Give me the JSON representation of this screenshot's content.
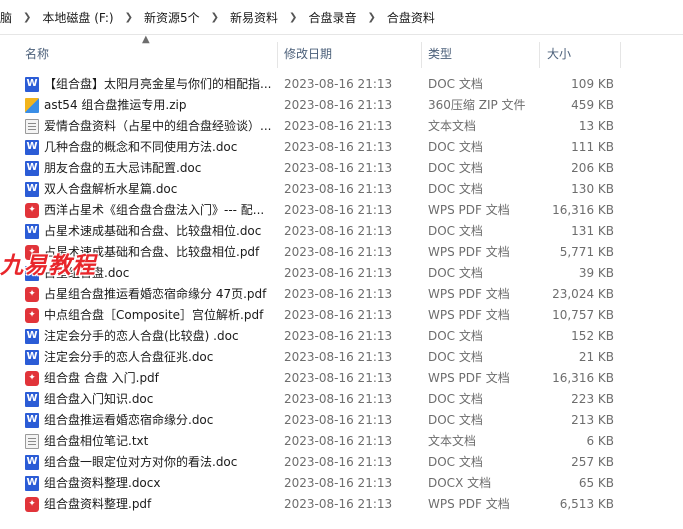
{
  "breadcrumb": [
    "脑",
    "本地磁盘 (F:)",
    "新资源5个",
    "新易资料",
    "合盘录音",
    "合盘资料"
  ],
  "columns": {
    "name": "名称",
    "date": "修改日期",
    "type": "类型",
    "size": "大小"
  },
  "watermark": "九易教程",
  "files": [
    {
      "icon": "doc",
      "name": "【组合盘】太阳月亮金星与你们的相配指...",
      "date": "2023-08-16 21:13",
      "type": "DOC 文档",
      "size": "109 KB"
    },
    {
      "icon": "zip",
      "name": "ast54 组合盘推运专用.zip",
      "date": "2023-08-16 21:13",
      "type": "360压缩 ZIP 文件",
      "size": "459 KB"
    },
    {
      "icon": "txt",
      "name": "爱情合盘资料（占星中的组合盘经验谈）...",
      "date": "2023-08-16 21:13",
      "type": "文本文档",
      "size": "13 KB"
    },
    {
      "icon": "doc",
      "name": "几种合盘的概念和不同使用方法.doc",
      "date": "2023-08-16 21:13",
      "type": "DOC 文档",
      "size": "111 KB"
    },
    {
      "icon": "doc",
      "name": "朋友合盘的五大忌讳配置.doc",
      "date": "2023-08-16 21:13",
      "type": "DOC 文档",
      "size": "206 KB"
    },
    {
      "icon": "doc",
      "name": "双人合盘解析水星篇.doc",
      "date": "2023-08-16 21:13",
      "type": "DOC 文档",
      "size": "130 KB"
    },
    {
      "icon": "pdf",
      "name": "西洋占星术《组合盘合盘法入门》--- 配...",
      "date": "2023-08-16 21:13",
      "type": "WPS PDF 文档",
      "size": "16,316 KB"
    },
    {
      "icon": "doc",
      "name": "占星术速成基础和合盘、比较盘相位.doc",
      "date": "2023-08-16 21:13",
      "type": "DOC 文档",
      "size": "131 KB"
    },
    {
      "icon": "pdf",
      "name": "占星术速成基础和合盘、比较盘相位.pdf",
      "date": "2023-08-16 21:13",
      "type": "WPS PDF 文档",
      "size": "5,771 KB"
    },
    {
      "icon": "doc",
      "name": "占星组合盘.doc",
      "date": "2023-08-16 21:13",
      "type": "DOC 文档",
      "size": "39 KB"
    },
    {
      "icon": "pdf",
      "name": "占星组合盘推运看婚恋宿命缘分 47页.pdf",
      "date": "2023-08-16 21:13",
      "type": "WPS PDF 文档",
      "size": "23,024 KB"
    },
    {
      "icon": "pdf",
      "name": "中点组合盘［Composite］宫位解析.pdf",
      "date": "2023-08-16 21:13",
      "type": "WPS PDF 文档",
      "size": "10,757 KB"
    },
    {
      "icon": "doc",
      "name": "注定会分手的恋人合盘(比较盘) .doc",
      "date": "2023-08-16 21:13",
      "type": "DOC 文档",
      "size": "152 KB"
    },
    {
      "icon": "doc",
      "name": "注定会分手的恋人合盘征兆.doc",
      "date": "2023-08-16 21:13",
      "type": "DOC 文档",
      "size": "21 KB"
    },
    {
      "icon": "pdf",
      "name": "组合盘 合盘 入门.pdf",
      "date": "2023-08-16 21:13",
      "type": "WPS PDF 文档",
      "size": "16,316 KB"
    },
    {
      "icon": "doc",
      "name": "组合盘入门知识.doc",
      "date": "2023-08-16 21:13",
      "type": "DOC 文档",
      "size": "223 KB"
    },
    {
      "icon": "doc",
      "name": "组合盘推运看婚恋宿命缘分.doc",
      "date": "2023-08-16 21:13",
      "type": "DOC 文档",
      "size": "213 KB"
    },
    {
      "icon": "txt",
      "name": "组合盘相位笔记.txt",
      "date": "2023-08-16 21:13",
      "type": "文本文档",
      "size": "6 KB"
    },
    {
      "icon": "doc",
      "name": "组合盘一眼定位对方对你的看法.doc",
      "date": "2023-08-16 21:13",
      "type": "DOC 文档",
      "size": "257 KB"
    },
    {
      "icon": "doc",
      "name": "组合盘资料整理.docx",
      "date": "2023-08-16 21:13",
      "type": "DOCX 文档",
      "size": "65 KB"
    },
    {
      "icon": "pdf",
      "name": "组合盘资料整理.pdf",
      "date": "2023-08-16 21:13",
      "type": "WPS PDF 文档",
      "size": "6,513 KB"
    }
  ]
}
